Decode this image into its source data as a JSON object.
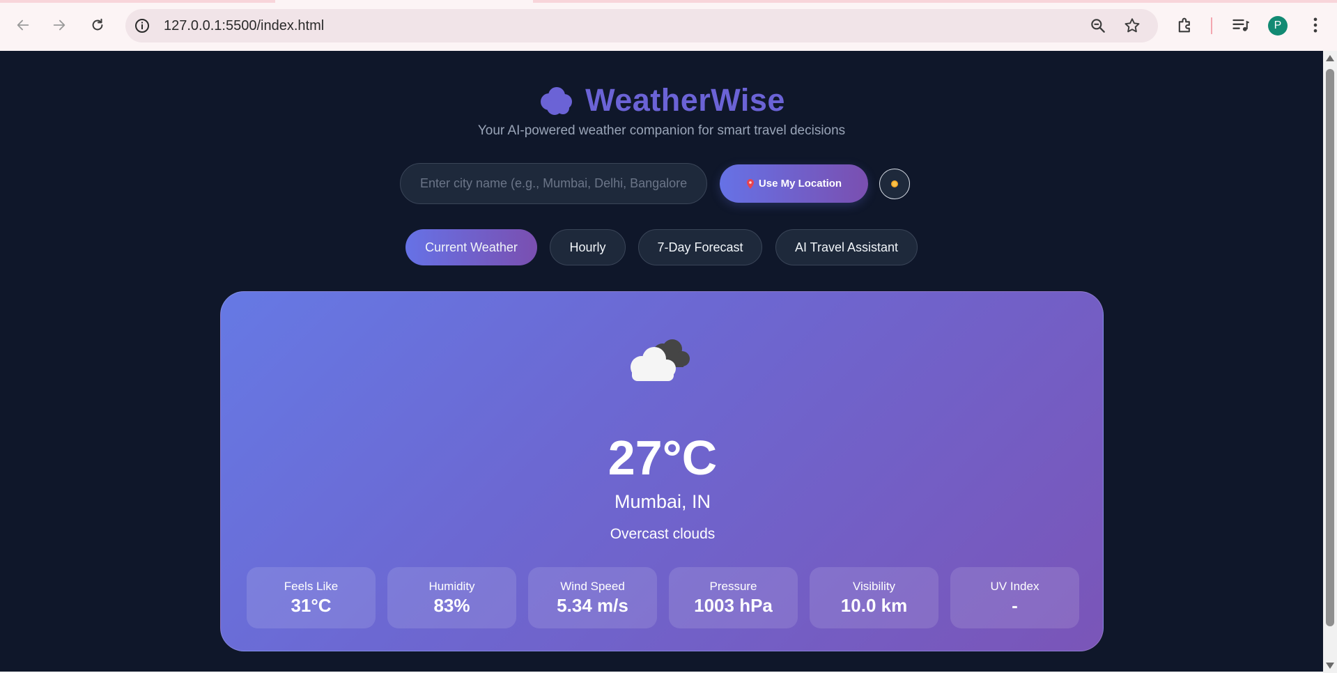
{
  "browser": {
    "url": "127.0.0.1:5500/index.html",
    "profile_initial": "P"
  },
  "app": {
    "title": "WeatherWise",
    "tagline": "Your AI-powered weather companion for smart travel decisions",
    "brand_color": "#6b63d6"
  },
  "search": {
    "placeholder": "Enter city name (e.g., Mumbai, Delhi, Bangalore..",
    "value": "",
    "location_button": "Use My Location"
  },
  "tabs": [
    {
      "label": "Current Weather",
      "active": true
    },
    {
      "label": "Hourly",
      "active": false
    },
    {
      "label": "7-Day Forecast",
      "active": false
    },
    {
      "label": "AI Travel Assistant",
      "active": false
    }
  ],
  "current": {
    "icon": "overcast-cloud-icon",
    "temperature": "27°C",
    "location": "Mumbai, IN",
    "description": "Overcast clouds"
  },
  "stats": [
    {
      "label": "Feels Like",
      "value": "31°C"
    },
    {
      "label": "Humidity",
      "value": "83%"
    },
    {
      "label": "Wind Speed",
      "value": "5.34 m/s"
    },
    {
      "label": "Pressure",
      "value": "1003 hPa"
    },
    {
      "label": "Visibility",
      "value": "10.0 km"
    },
    {
      "label": "UV Index",
      "value": "-"
    }
  ],
  "colors": {
    "page_bg": "#0f172a",
    "accent_start": "#6672e6",
    "accent_end": "#7a4fb0"
  }
}
